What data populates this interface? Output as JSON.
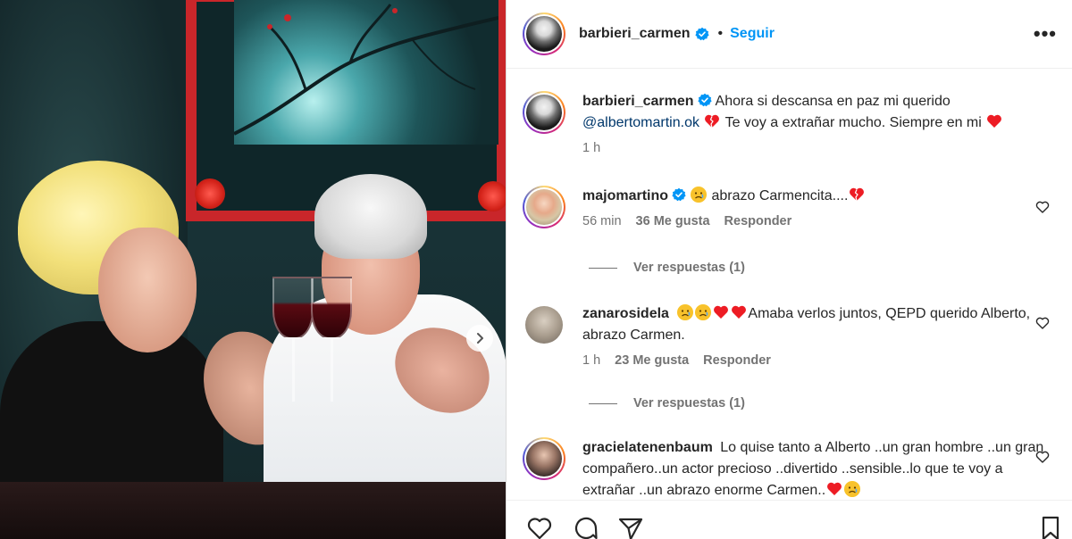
{
  "post": {
    "author": "barbieri_carmen",
    "follow_label": "Seguir",
    "separator": "•",
    "more_label": "•••"
  },
  "caption": {
    "username": "barbieri_carmen",
    "text_before": "Ahora si descansa en paz mi querido",
    "mention": "@albertomartin.ok",
    "text_after": "Te voy a extrañar mucho. Siempre en mi",
    "time": "1 h"
  },
  "comments": [
    {
      "username": "majomartino",
      "text": "abrazo Carmencita....",
      "time": "56 min",
      "likes": "36 Me gusta",
      "reply_label": "Responder",
      "view_replies": "Ver respuestas (1)"
    },
    {
      "username": "zanarosidela",
      "text": "Amaba verlos juntos, QEPD querido Alberto, abrazo Carmen.",
      "time": "1 h",
      "likes": "23 Me gusta",
      "reply_label": "Responder",
      "view_replies": "Ver respuestas (1)"
    },
    {
      "username": "gracielatenenbaum",
      "text": "Lo quise tanto a Alberto ..un gran hombre ..un gran compañero..un actor precioso ..divertido ..sensible..lo que te voy a extrañar ..un abrazo enorme Carmen..",
      "time": "",
      "likes": "",
      "reply_label": "",
      "view_replies": ""
    }
  ],
  "colors": {
    "link_blue": "#0095f6",
    "mention_blue": "#00376b",
    "verified_blue": "#0095f6",
    "heart_red": "#ed1c24",
    "text_muted": "#737373"
  },
  "icons": {
    "header": [
      "verified-badge-icon",
      "more-options-icon"
    ],
    "photo": [
      "chevron-right-icon"
    ],
    "actions": [
      "heart-icon",
      "comment-icon",
      "share-icon",
      "bookmark-icon"
    ]
  }
}
